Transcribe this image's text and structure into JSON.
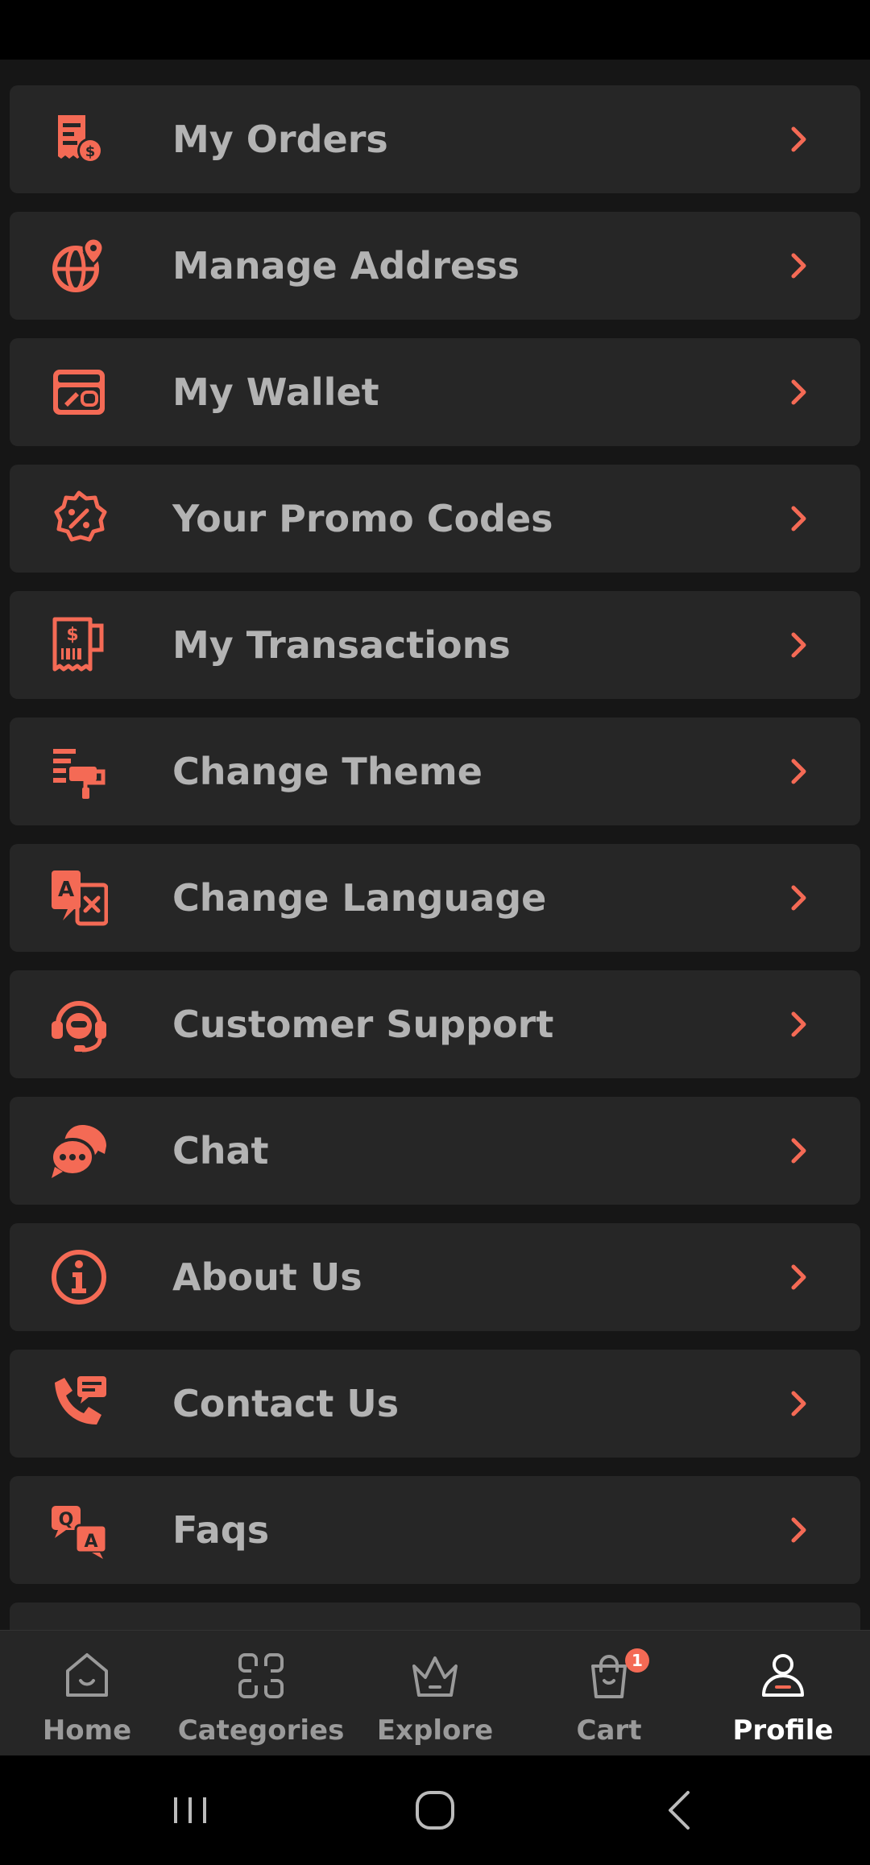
{
  "colors": {
    "accent": "#f46a55",
    "background": "#161616",
    "card": "#262626",
    "label": "#b3b3b3",
    "active_nav": "#ffffff"
  },
  "menu": {
    "items": [
      {
        "label": "My Orders",
        "icon": "receipt-dollar-icon"
      },
      {
        "label": "Manage Address",
        "icon": "globe-pin-icon"
      },
      {
        "label": "My Wallet",
        "icon": "wallet-icon"
      },
      {
        "label": "Your Promo Codes",
        "icon": "percent-badge-icon"
      },
      {
        "label": "My Transactions",
        "icon": "transaction-receipt-icon"
      },
      {
        "label": "Change Theme",
        "icon": "paint-roller-icon"
      },
      {
        "label": "Change Language",
        "icon": "translate-icon"
      },
      {
        "label": "Customer Support",
        "icon": "headset-icon"
      },
      {
        "label": "Chat",
        "icon": "chat-bubbles-icon"
      },
      {
        "label": "About Us",
        "icon": "info-icon"
      },
      {
        "label": "Contact Us",
        "icon": "phone-message-icon"
      },
      {
        "label": "Faqs",
        "icon": "qa-icon"
      }
    ]
  },
  "bottom_nav": {
    "items": [
      {
        "label": "Home",
        "icon": "home-icon"
      },
      {
        "label": "Categories",
        "icon": "categories-icon"
      },
      {
        "label": "Explore",
        "icon": "crown-icon"
      },
      {
        "label": "Cart",
        "icon": "shopping-bag-icon",
        "badge": "1"
      },
      {
        "label": "Profile",
        "icon": "profile-icon",
        "active": true
      }
    ]
  },
  "system_nav": {
    "buttons": [
      "recent-apps-icon",
      "home-button-icon",
      "back-icon"
    ]
  }
}
